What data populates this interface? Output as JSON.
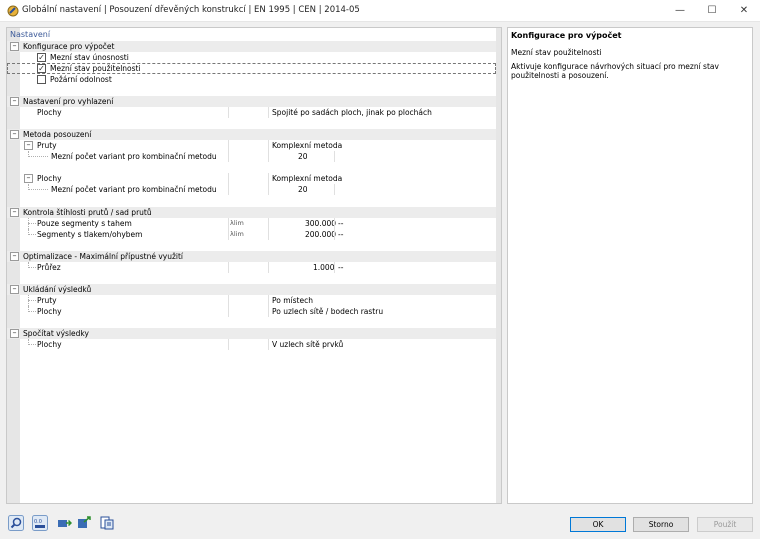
{
  "window": {
    "title": "Globální nastavení | Posouzení dřevěných konstrukcí | EN 1995 | CEN | 2014-05"
  },
  "left_panel": {
    "header": "Nastavení",
    "sections": [
      {
        "title": "Konfigurace pro výpočet",
        "checks": [
          {
            "label": "Mezní stav únosnosti",
            "checked": true
          },
          {
            "label": "Mezní stav použitelnosti",
            "checked": true
          },
          {
            "label": "Požární odolnost",
            "checked": false
          }
        ]
      },
      {
        "title": "Nastavení pro vyhlazení",
        "rows": [
          {
            "label": "Plochy",
            "value": "Spojité po sadách ploch, jinak po plochách"
          }
        ]
      },
      {
        "title": "Metoda posouzení",
        "rows": [
          {
            "label": "Pruty",
            "value": "Komplexní metoda"
          },
          {
            "label": "Mezní počet variant pro kombinační metodu",
            "value": "20"
          },
          {
            "label": "Plochy",
            "value": "Komplexní metoda"
          },
          {
            "label": "Mezní počet variant pro kombinační metodu",
            "value": "20"
          }
        ]
      },
      {
        "title": "Kontrola štíhlosti prutů / sad prutů",
        "rows": [
          {
            "label": "Pouze segmenty s tahem",
            "symbol": "λlim",
            "value": "300.000",
            "unit": "--"
          },
          {
            "label": "Segmenty s tlakem/ohybem",
            "symbol": "λlim",
            "value": "200.000",
            "unit": "--"
          }
        ]
      },
      {
        "title": "Optimalizace - Maximální přípustné využití",
        "rows": [
          {
            "label": "Průřez",
            "value": "1.000",
            "unit": "--"
          }
        ]
      },
      {
        "title": "Ukládání výsledků",
        "rows": [
          {
            "label": "Pruty",
            "value": "Po místech"
          },
          {
            "label": "Plochy",
            "value": "Po uzlech sítě / bodech rastru"
          }
        ]
      },
      {
        "title": "Spočítat výsledky",
        "rows": [
          {
            "label": "Plochy",
            "value": "V uzlech sítě prvků"
          }
        ]
      }
    ]
  },
  "right_panel": {
    "title": "Konfigurace pro výpočet",
    "subtitle": "Mezní stav použitelnosti",
    "description": "Aktivuje konfigurace návrhových situací pro mezní stav použitelnosti a posouzení."
  },
  "buttons": {
    "ok": "OK",
    "cancel": "Storno",
    "apply": "Použít"
  },
  "icons": {
    "app": "app-icon",
    "minimize": "minimize-icon",
    "maximize": "maximize-icon",
    "close": "close-icon",
    "toolbar": [
      "search-icon",
      "units-icon",
      "import-icon",
      "export-icon",
      "defaults-icon"
    ]
  },
  "colors": {
    "accent": "#3c5a99",
    "category_bg": "#ececec",
    "ok_border": "#0078d7"
  }
}
